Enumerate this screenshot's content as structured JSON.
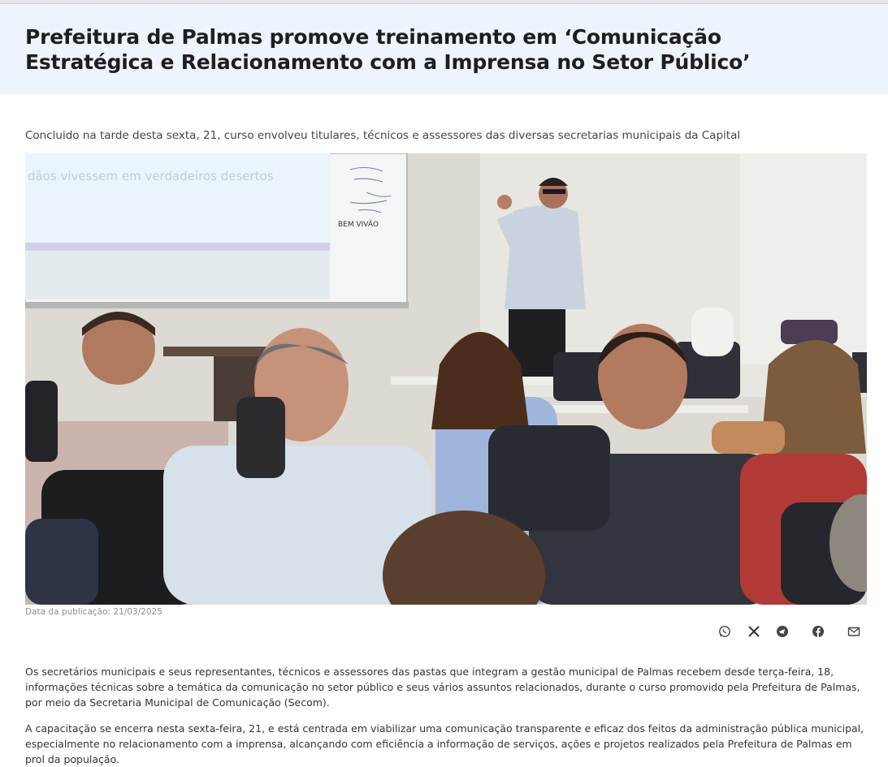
{
  "article": {
    "title": "Prefeitura de Palmas promove treinamento em ‘Comunicação Estratégica e Relacionamento com a Imprensa no Setor Público’",
    "subtitle": "Concluido na tarde desta sexta, 21, curso envolveu titulares, técnicos e assessores das diversas secretarias municipais da Capital",
    "photo": {
      "slide_text": "dãos vivessem em verdadeiros desertos",
      "board_scribble": "BEM VIVÃO"
    },
    "publication_date": "Data da publicação: 21/03/2025",
    "paragraphs": [
      "Os secretários municipais e seus representantes, técnicos e assessores das pastas que integram a gestão municipal de Palmas recebem desde terça-feira, 18, informações técnicas sobre a temática da comunicação no setor público e seus vários assuntos relacionados, durante o curso promovido pela Prefeitura de Palmas, por meio da Secretaria Municipal de Comunicação (Secom).",
      "A capacitação se encerra nesta sexta-feira, 21, e está centrada em viabilizar uma comunicação transparente e eficaz dos feitos da administração pública municipal, especialmente no relacionamento com a imprensa, alcançando com eficiência a informação de serviços, ações e projetos realizados pela Prefeitura de Palmas em prol da população."
    ]
  },
  "share_icons": [
    "whatsapp-icon",
    "x-icon",
    "telegram-icon",
    "facebook-icon",
    "email-icon"
  ],
  "colors": {
    "header_bg": "#eef4fb",
    "title": "#1e1e1e",
    "body_text": "#333333",
    "caption": "#8c8c8c",
    "icons": "#444444"
  }
}
